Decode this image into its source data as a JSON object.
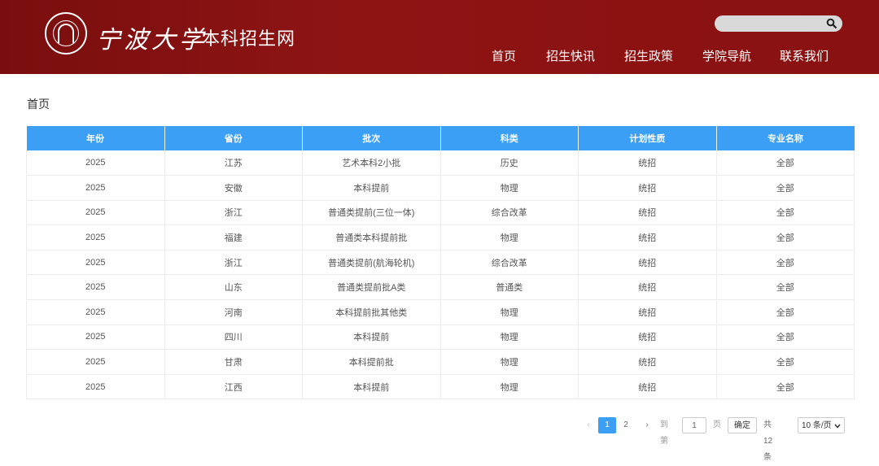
{
  "header": {
    "school_name": "宁波大学",
    "site_name": "本科招生网",
    "search": {
      "placeholder": "",
      "icon": "search-icon"
    },
    "nav": [
      {
        "label": "首页"
      },
      {
        "label": "招生快讯"
      },
      {
        "label": "招生政策"
      },
      {
        "label": "学院导航"
      },
      {
        "label": "联系我们"
      }
    ]
  },
  "breadcrumb": "首页",
  "table": {
    "columns": [
      "年份",
      "省份",
      "批次",
      "科类",
      "计划性质",
      "专业名称"
    ],
    "rows": [
      [
        "2025",
        "江苏",
        "艺术本科2小批",
        "历史",
        "统招",
        "全部"
      ],
      [
        "2025",
        "安徽",
        "本科提前",
        "物理",
        "统招",
        "全部"
      ],
      [
        "2025",
        "浙江",
        "普通类提前(三位一体)",
        "综合改革",
        "统招",
        "全部"
      ],
      [
        "2025",
        "福建",
        "普通类本科提前批",
        "物理",
        "统招",
        "全部"
      ],
      [
        "2025",
        "浙江",
        "普通类提前(航海轮机)",
        "综合改革",
        "统招",
        "全部"
      ],
      [
        "2025",
        "山东",
        "普通类提前批A类",
        "普通类",
        "统招",
        "全部"
      ],
      [
        "2025",
        "河南",
        "本科提前批其他类",
        "物理",
        "统招",
        "全部"
      ],
      [
        "2025",
        "四川",
        "本科提前",
        "物理",
        "统招",
        "全部"
      ],
      [
        "2025",
        "甘肃",
        "本科提前批",
        "物理",
        "统招",
        "全部"
      ],
      [
        "2025",
        "江西",
        "本科提前",
        "物理",
        "统招",
        "全部"
      ]
    ]
  },
  "pager": {
    "prev": "‹",
    "pages": [
      "1",
      "2"
    ],
    "current": "1",
    "next": "›",
    "goto_label": "到第",
    "goto_value": "1",
    "page_unit": "页",
    "confirm": "确定",
    "total": "共 12 条",
    "page_size": "10 条/页"
  },
  "colors": {
    "header_bg": "#8a1111",
    "accent": "#3a9ff5"
  }
}
